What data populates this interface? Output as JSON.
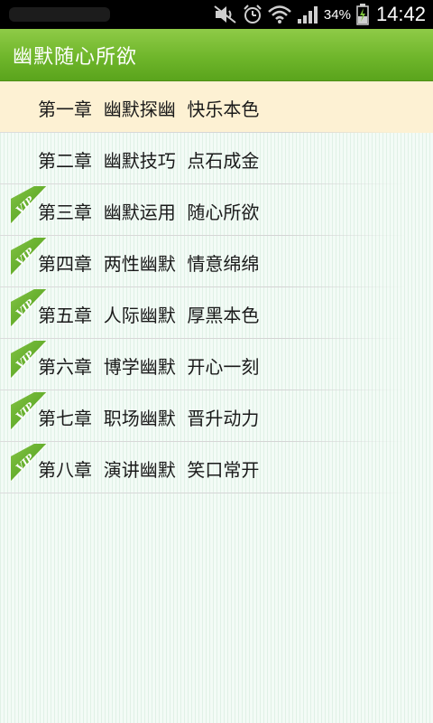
{
  "status_bar": {
    "battery_percent": "34%",
    "time": "14:42",
    "icons": [
      "mute-icon",
      "alarm-icon",
      "wifi-icon",
      "signal-icon",
      "battery-charging-icon"
    ]
  },
  "title_bar": {
    "title": "幽默随心所欲"
  },
  "chapters": [
    {
      "label": "第一章  幽默探幽  快乐本色",
      "vip": false,
      "selected": true
    },
    {
      "label": "第二章  幽默技巧  点石成金",
      "vip": false,
      "selected": false
    },
    {
      "label": "第三章  幽默运用  随心所欲",
      "vip": true,
      "selected": false
    },
    {
      "label": "第四章  两性幽默  情意绵绵",
      "vip": true,
      "selected": false
    },
    {
      "label": "第五章  人际幽默  厚黑本色",
      "vip": true,
      "selected": false
    },
    {
      "label": "第六章  博学幽默  开心一刻",
      "vip": true,
      "selected": false
    },
    {
      "label": "第七章  职场幽默  晋升动力",
      "vip": true,
      "selected": false
    },
    {
      "label": "第八章  演讲幽默  笑口常开",
      "vip": true,
      "selected": false
    }
  ],
  "colors": {
    "title_bar_green": "#6fb62b",
    "selected_row": "#fdf1d3",
    "vip_badge_green": "#5fae24"
  }
}
